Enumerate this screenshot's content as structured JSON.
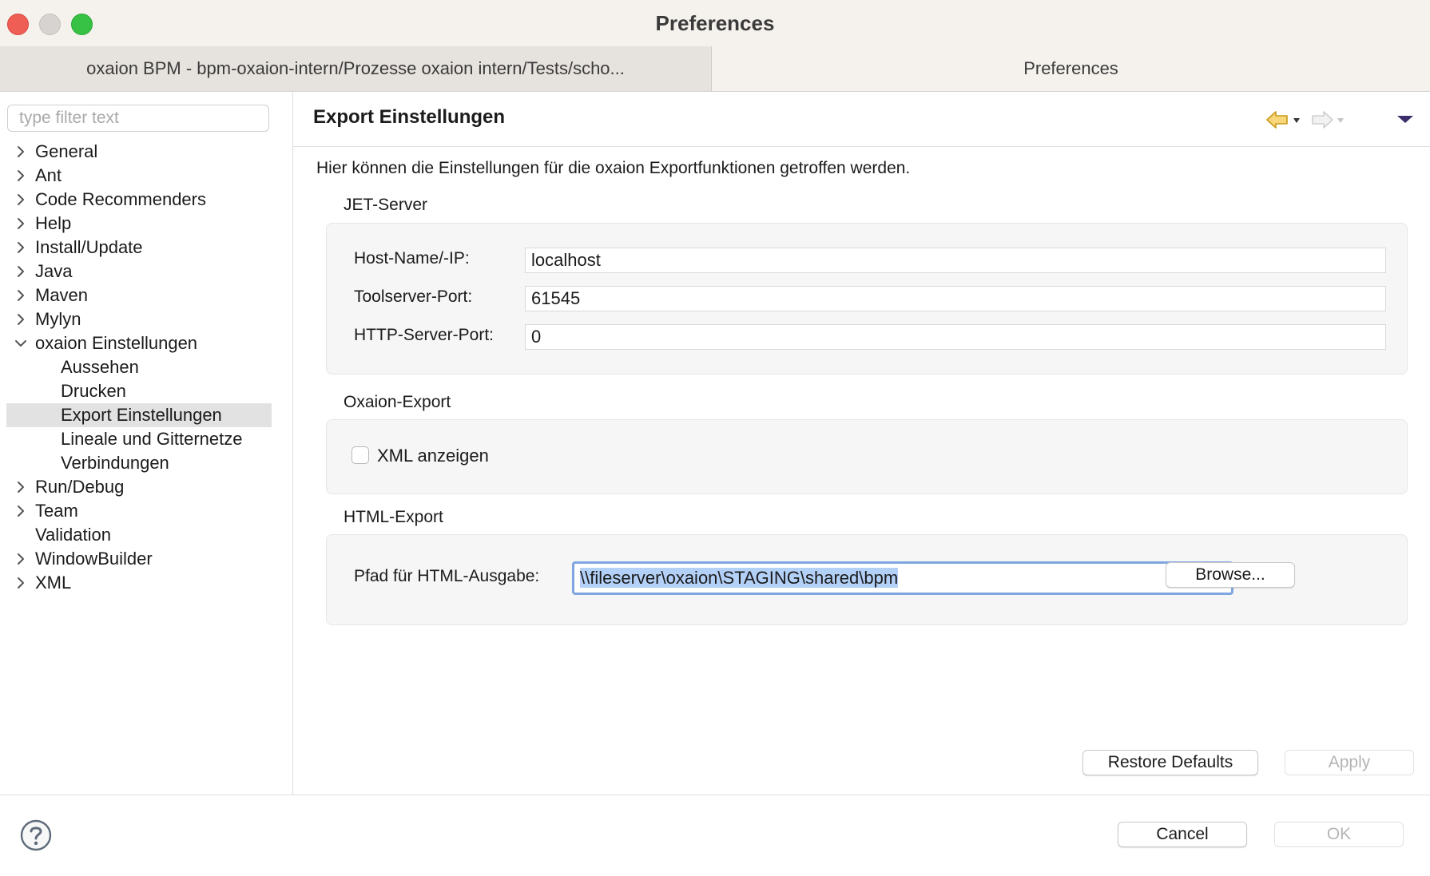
{
  "window": {
    "title": "Preferences",
    "colors": {
      "close": "#ee5e55",
      "minimize": "#d6d3d0",
      "maximize": "#37c145"
    }
  },
  "tabs": [
    {
      "label": "oxaion BPM - bpm-oxaion-intern/Prozesse oxaion intern/Tests/scho..."
    },
    {
      "label": "Preferences"
    }
  ],
  "filter": {
    "placeholder": "type filter text",
    "value": ""
  },
  "tree": {
    "items": [
      {
        "label": "General",
        "level": 0,
        "expander": "collapsed"
      },
      {
        "label": "Ant",
        "level": 0,
        "expander": "collapsed"
      },
      {
        "label": "Code Recommenders",
        "level": 0,
        "expander": "collapsed"
      },
      {
        "label": "Help",
        "level": 0,
        "expander": "collapsed"
      },
      {
        "label": "Install/Update",
        "level": 0,
        "expander": "collapsed"
      },
      {
        "label": "Java",
        "level": 0,
        "expander": "collapsed"
      },
      {
        "label": "Maven",
        "level": 0,
        "expander": "collapsed"
      },
      {
        "label": "Mylyn",
        "level": 0,
        "expander": "collapsed"
      },
      {
        "label": "oxaion Einstellungen",
        "level": 0,
        "expander": "expanded"
      },
      {
        "label": "Aussehen",
        "level": 1,
        "expander": "none"
      },
      {
        "label": "Drucken",
        "level": 1,
        "expander": "none"
      },
      {
        "label": "Export Einstellungen",
        "level": 1,
        "expander": "none",
        "selected": true
      },
      {
        "label": "Lineale und Gitternetze",
        "level": 1,
        "expander": "none"
      },
      {
        "label": "Verbindungen",
        "level": 1,
        "expander": "none"
      },
      {
        "label": "Run/Debug",
        "level": 0,
        "expander": "collapsed"
      },
      {
        "label": "Team",
        "level": 0,
        "expander": "collapsed"
      },
      {
        "label": "Validation",
        "level": 0,
        "expander": "none"
      },
      {
        "label": "WindowBuilder",
        "level": 0,
        "expander": "collapsed"
      },
      {
        "label": "XML",
        "level": 0,
        "expander": "collapsed"
      }
    ]
  },
  "page": {
    "title": "Export Einstellungen",
    "description": "Hier können die Einstellungen für die oxaion Exportfunktionen getroffen werden.",
    "back_icon": "back-arrow-icon",
    "forward_icon": "forward-arrow-icon",
    "menu_icon": "view-menu-icon",
    "jet_server": {
      "title": "JET-Server",
      "host_label": "Host-Name/-IP:",
      "host_value": "localhost",
      "toolserver_label": "Toolserver-Port:",
      "toolserver_value": "61545",
      "http_label": "HTTP-Server-Port:",
      "http_value": "0"
    },
    "oxaion_export": {
      "title": "Oxaion-Export",
      "xml_label": "XML anzeigen",
      "xml_checked": false
    },
    "html_export": {
      "title": "HTML-Export",
      "path_label": "Pfad für HTML-Ausgabe:",
      "path_value": "\\\\fileserver\\oxaion\\STAGING\\shared\\bpm",
      "browse_label": "Browse..."
    },
    "restore_label": "Restore Defaults",
    "apply_label": "Apply"
  },
  "footer": {
    "help_icon": "help-icon",
    "cancel_label": "Cancel",
    "ok_label": "OK"
  }
}
